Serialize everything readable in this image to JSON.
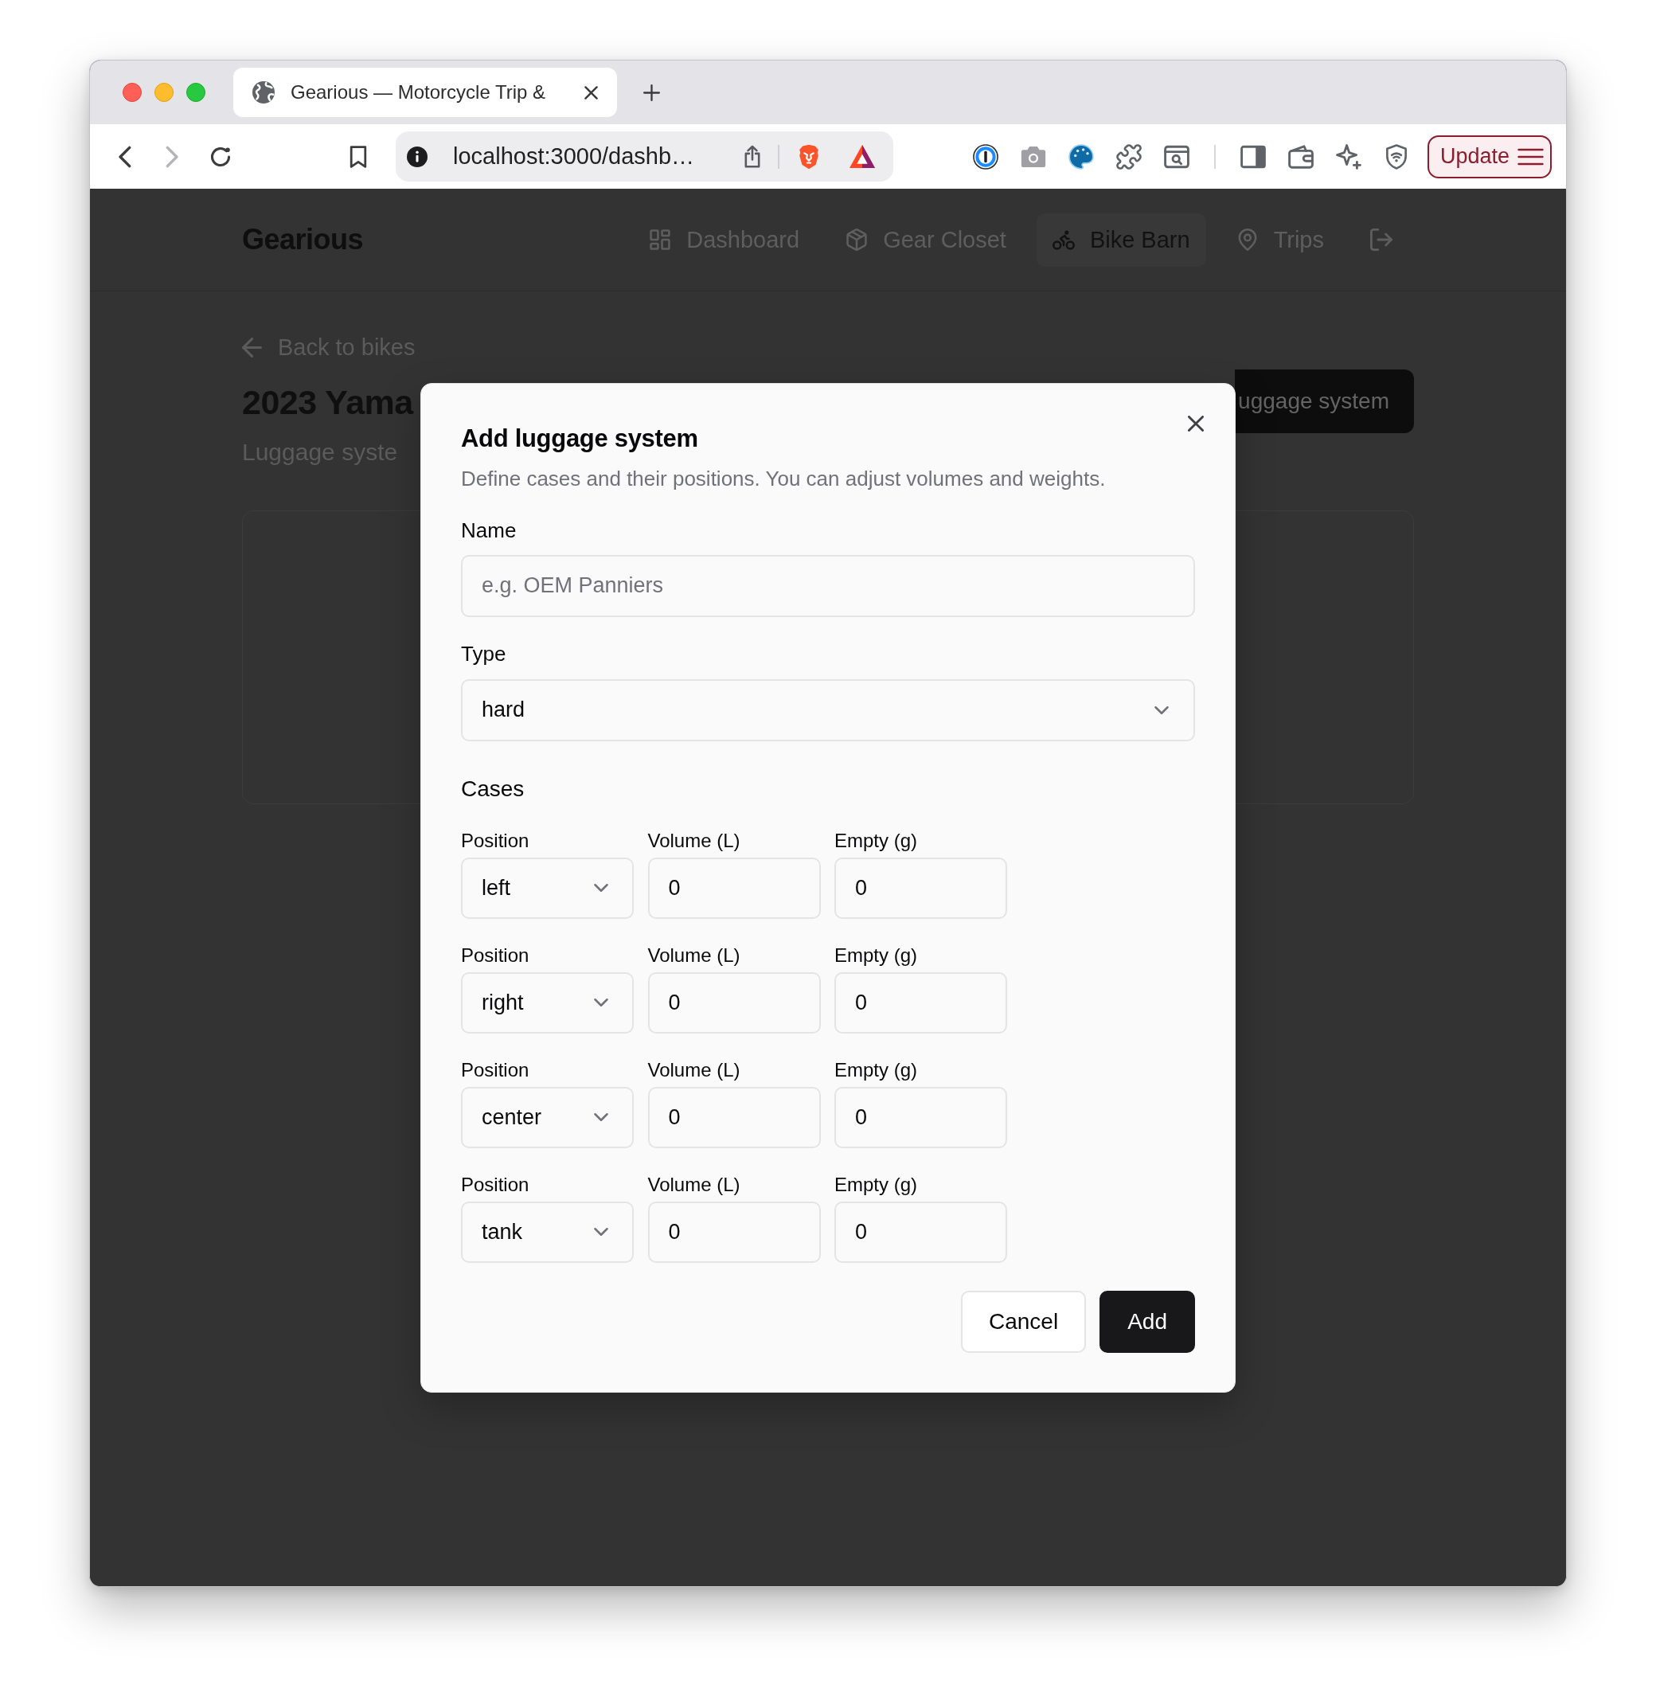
{
  "browser": {
    "tabs": [
      {
        "title": "Gearious — Motorcycle Trip &",
        "selected": true
      }
    ],
    "toolbar": {
      "back": {
        "disabled": false
      },
      "forward": {
        "disabled": true
      },
      "address_bar": {
        "url": "localhost:3000/dashb…"
      },
      "update_button": "Update"
    }
  },
  "app": {
    "brand": "Gearious",
    "nav": [
      {
        "label": "Dashboard",
        "selected": false
      },
      {
        "label": "Gear Closet",
        "selected": false
      },
      {
        "label": "Bike Barn",
        "selected": true
      },
      {
        "label": "Trips",
        "selected": false
      }
    ]
  },
  "page": {
    "back_link": "Back to bikes",
    "title": "2023 Yama",
    "subtitle": "Luggage syste",
    "action_button": "uggage system"
  },
  "dialog": {
    "title": "Add luggage system",
    "description": "Define cases and their positions. You can adjust volumes and weights.",
    "fields": [
      {
        "label": "Name",
        "kind": "input",
        "placeholder": "e.g. OEM Panniers"
      },
      {
        "label": "Type",
        "kind": "select",
        "value": "hard"
      }
    ],
    "cases_heading": "Cases",
    "cases": [
      {
        "fields": [
          {
            "label": "Position",
            "kind": "select",
            "value": "left"
          },
          {
            "label": "Volume (L)",
            "kind": "input",
            "value": "0"
          },
          {
            "label": "Empty (g)",
            "kind": "input",
            "value": "0"
          }
        ]
      },
      {
        "fields": [
          {
            "label": "Position",
            "kind": "select",
            "value": "right"
          },
          {
            "label": "Volume (L)",
            "kind": "input",
            "value": "0"
          },
          {
            "label": "Empty (g)",
            "kind": "input",
            "value": "0"
          }
        ]
      },
      {
        "fields": [
          {
            "label": "Position",
            "kind": "select",
            "value": "center"
          },
          {
            "label": "Volume (L)",
            "kind": "input",
            "value": "0"
          },
          {
            "label": "Empty (g)",
            "kind": "input",
            "value": "0"
          }
        ]
      },
      {
        "fields": [
          {
            "label": "Position",
            "kind": "select",
            "value": "tank"
          },
          {
            "label": "Volume (L)",
            "kind": "input",
            "value": "0"
          },
          {
            "label": "Empty (g)",
            "kind": "input",
            "value": "0"
          }
        ]
      }
    ],
    "buttons": [
      {
        "label": "Cancel",
        "kind": "secondary"
      },
      {
        "label": "Add",
        "kind": "primary"
      }
    ]
  }
}
